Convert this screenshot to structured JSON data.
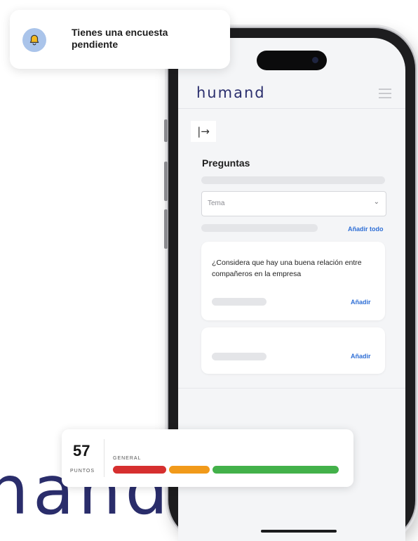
{
  "background_brand": "hand",
  "app": {
    "logo": "humand",
    "section_title": "Preguntas",
    "select": {
      "placeholder": "Tema"
    },
    "add_all_label": "Añadir todo",
    "questions": [
      {
        "text": "¿Considera que hay una buena relación entre compañeros en la empresa",
        "add_label": "Añadir"
      },
      {
        "text": "",
        "add_label": "Añadir"
      }
    ]
  },
  "notification": {
    "text": "Tienes una encuesta pendiente"
  },
  "score": {
    "value": "57",
    "unit": "PUNTOS",
    "category": "GENERAL",
    "segments": [
      {
        "color": "#d62f2f"
      },
      {
        "color": "#f19a1a"
      },
      {
        "color": "#43b14a"
      }
    ]
  },
  "colors": {
    "brand": "#2a2d6b",
    "link": "#2f6fd6",
    "bell_bg": "#aac4ea"
  }
}
